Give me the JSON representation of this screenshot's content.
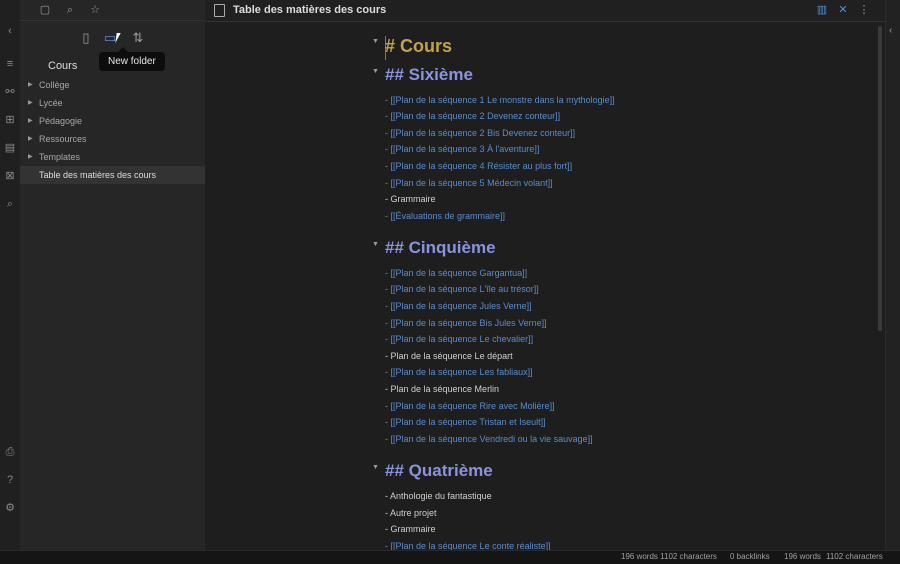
{
  "ribbon": {
    "collapse": "‹",
    "icons": [
      "≡",
      "⚯",
      "⊞",
      "▤",
      "⊠",
      "⌕"
    ],
    "bottom_icons": [
      "⎙",
      "?",
      "⚙"
    ]
  },
  "sidebar": {
    "top_icons": [
      "▢",
      "⌕",
      "☆"
    ],
    "actions": {
      "new_note": "▯",
      "new_folder": "▭",
      "sort": "⇅"
    },
    "tooltip": "New folder",
    "vault": "Cours",
    "folders": [
      "Collège",
      "Lycée",
      "Pédagogie",
      "Ressources",
      "Templates"
    ],
    "files": [
      "Table des matières des cours"
    ]
  },
  "tab": {
    "title": "Table des matières des cours",
    "actions": {
      "reading": "▥",
      "close": "✕",
      "more": "⋮"
    }
  },
  "editor": {
    "h1": "# Cours",
    "sections": [
      {
        "heading": "## Sixième",
        "items": [
          {
            "text": "- [[Plan de la séquence 1 Le monstre dans la mythologie]]",
            "link": true
          },
          {
            "text": "- [[Plan de la séquence 2 Devenez conteur]]",
            "link": true
          },
          {
            "text": "- [[Plan de la séquence 2 Bis Devenez conteur]]",
            "link": true
          },
          {
            "text": "- [[Plan de la séquence 3 À l'aventure]]",
            "link": true
          },
          {
            "text": "- [[Plan de la séquence 4 Résister au plus fort]]",
            "link": true
          },
          {
            "text": "- [[Plan de la séquence 5 Médecin volant]]",
            "link": true
          },
          {
            "text": "- Grammaire",
            "link": false
          },
          {
            "text": "- [[Évaluations de grammaire]]",
            "link": true
          }
        ]
      },
      {
        "heading": "## Cinquième",
        "items": [
          {
            "text": "- [[Plan de la séquence Gargantua]]",
            "link": true
          },
          {
            "text": "- [[Plan de la séquence L'île au trésor]]",
            "link": true
          },
          {
            "text": "- [[Plan de la séquence Jules Verne]]",
            "link": true
          },
          {
            "text": "- [[Plan de la séquence Bis Jules Verne]]",
            "link": true
          },
          {
            "text": "- [[Plan de la séquence Le chevalier]]",
            "link": true
          },
          {
            "text": "- Plan de la séquence Le départ",
            "link": false
          },
          {
            "text": "- [[Plan de la séquence Les fabliaux]]",
            "link": true
          },
          {
            "text": "- Plan de la séquence Merlin",
            "link": false
          },
          {
            "text": "- [[Plan de la séquence Rire avec Molière]]",
            "link": true
          },
          {
            "text": "- [[Plan de la séquence Tristan et Iseult]]",
            "link": true
          },
          {
            "text": "- [[Plan de la séquence Vendredi ou la vie sauvage]]",
            "link": true
          }
        ]
      },
      {
        "heading": "## Quatrième",
        "items": [
          {
            "text": "- Anthologie du fantastique",
            "link": false
          },
          {
            "text": "- Autre projet",
            "link": false
          },
          {
            "text": "- Grammaire",
            "link": false
          },
          {
            "text": "- [[Plan de la séquence Le conte réaliste]]",
            "link": true
          }
        ]
      }
    ]
  },
  "status": {
    "words_chars": "196 words 1102 characters",
    "backlinks": "0 backlinks",
    "words": "196 words",
    "characters": "1102 characters"
  }
}
